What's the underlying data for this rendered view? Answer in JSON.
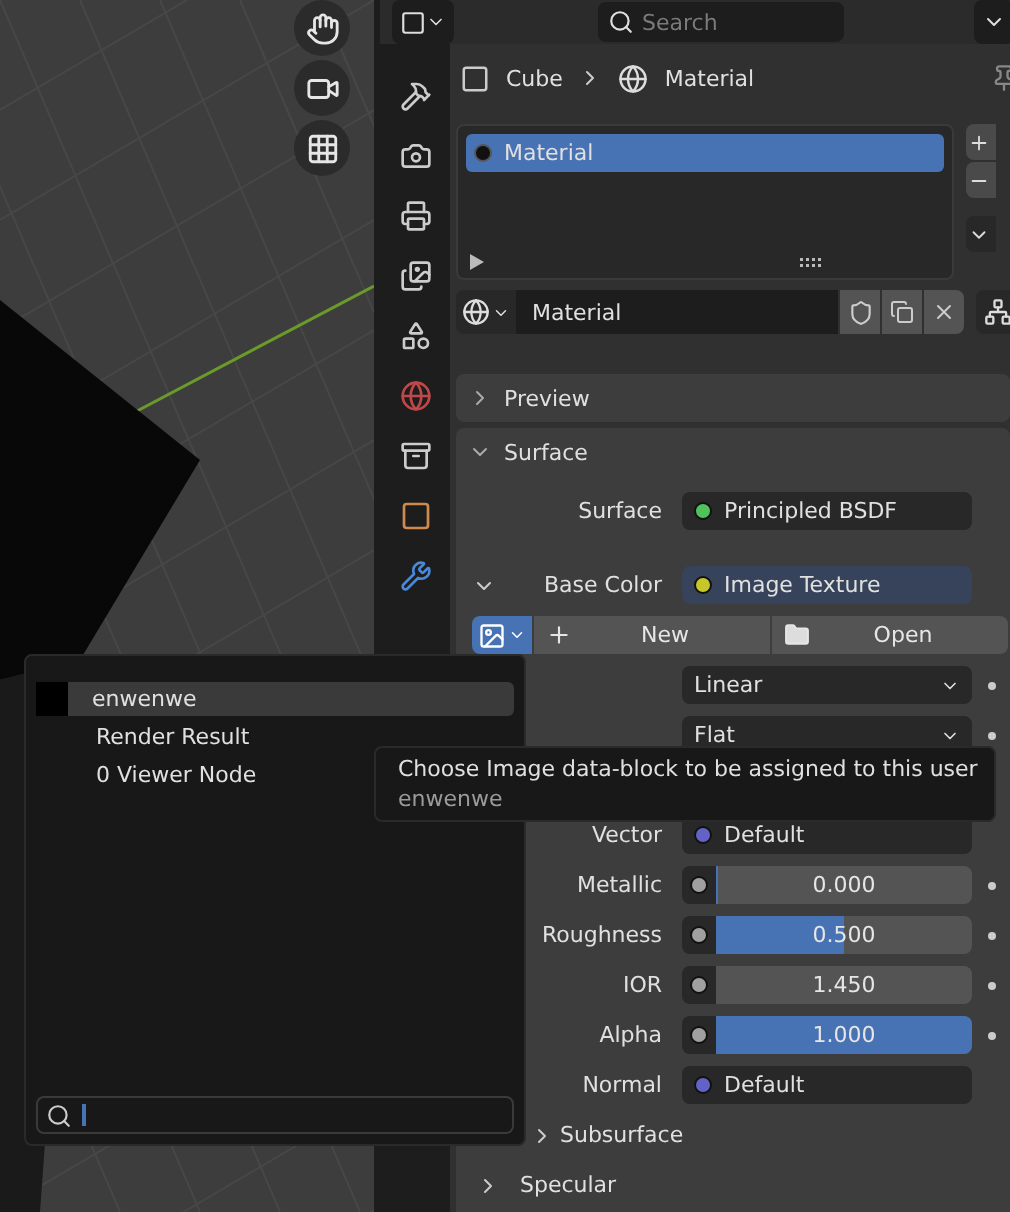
{
  "search": {
    "placeholder": "Search"
  },
  "tabs": [
    {
      "kind": "tool",
      "selected": false
    },
    {
      "kind": "render",
      "selected": false
    },
    {
      "kind": "output",
      "selected": false
    },
    {
      "kind": "view_layer",
      "selected": false
    },
    {
      "kind": "scene",
      "selected": false
    },
    {
      "kind": "world",
      "selected": false
    },
    {
      "kind": "collection",
      "selected": false
    },
    {
      "kind": "object",
      "selected": false
    },
    {
      "kind": "modifiers",
      "selected": false
    }
  ],
  "breadcrumb": {
    "object": "Cube",
    "material": "Material"
  },
  "material_slots": [
    {
      "name": "Material",
      "selected": true
    }
  ],
  "material_selector": {
    "value": "Material"
  },
  "panels": [
    {
      "title": "Preview",
      "expanded": false
    },
    {
      "title": "Surface",
      "expanded": true
    }
  ],
  "surface": [
    {
      "kind": "socket",
      "label": "Surface",
      "value": "Principled BSDF",
      "color": "#4fc35a"
    },
    {
      "kind": "socket",
      "label": "Base Color",
      "value": "Image Texture",
      "color": "#c7c729",
      "expanded": true
    }
  ],
  "image_buttons": {
    "new": "New",
    "open": "Open"
  },
  "image_settings": [
    {
      "value": "Linear"
    },
    {
      "value": "Flat"
    }
  ],
  "inputs": [
    {
      "kind": "socket",
      "label": "Vector",
      "value": "Default",
      "color": "#6363c7"
    },
    {
      "kind": "slider",
      "label": "Metallic",
      "value": "0.000",
      "level": 0
    },
    {
      "kind": "slider",
      "label": "Roughness",
      "value": "0.500",
      "level": 0.5
    },
    {
      "kind": "number",
      "label": "IOR",
      "value": "1.450"
    },
    {
      "kind": "slider",
      "label": "Alpha",
      "value": "1.000",
      "level": 1
    },
    {
      "kind": "socket",
      "label": "Normal",
      "value": "Default",
      "color": "#6363c7"
    }
  ],
  "subpanels": [
    {
      "title": "Subsurface",
      "expanded": false
    },
    {
      "title": "Specular",
      "expanded": false
    }
  ],
  "image_menu": {
    "items": [
      {
        "label": "enwenwe",
        "kind": "image",
        "selected": true
      },
      {
        "label": "Render Result",
        "kind": "plain",
        "selected": false
      },
      {
        "label": "0 Viewer Node",
        "kind": "plain",
        "selected": false
      }
    ]
  },
  "tooltip": {
    "text": "Choose Image data-block to be assigned to this user",
    "detail": "enwenwe"
  }
}
